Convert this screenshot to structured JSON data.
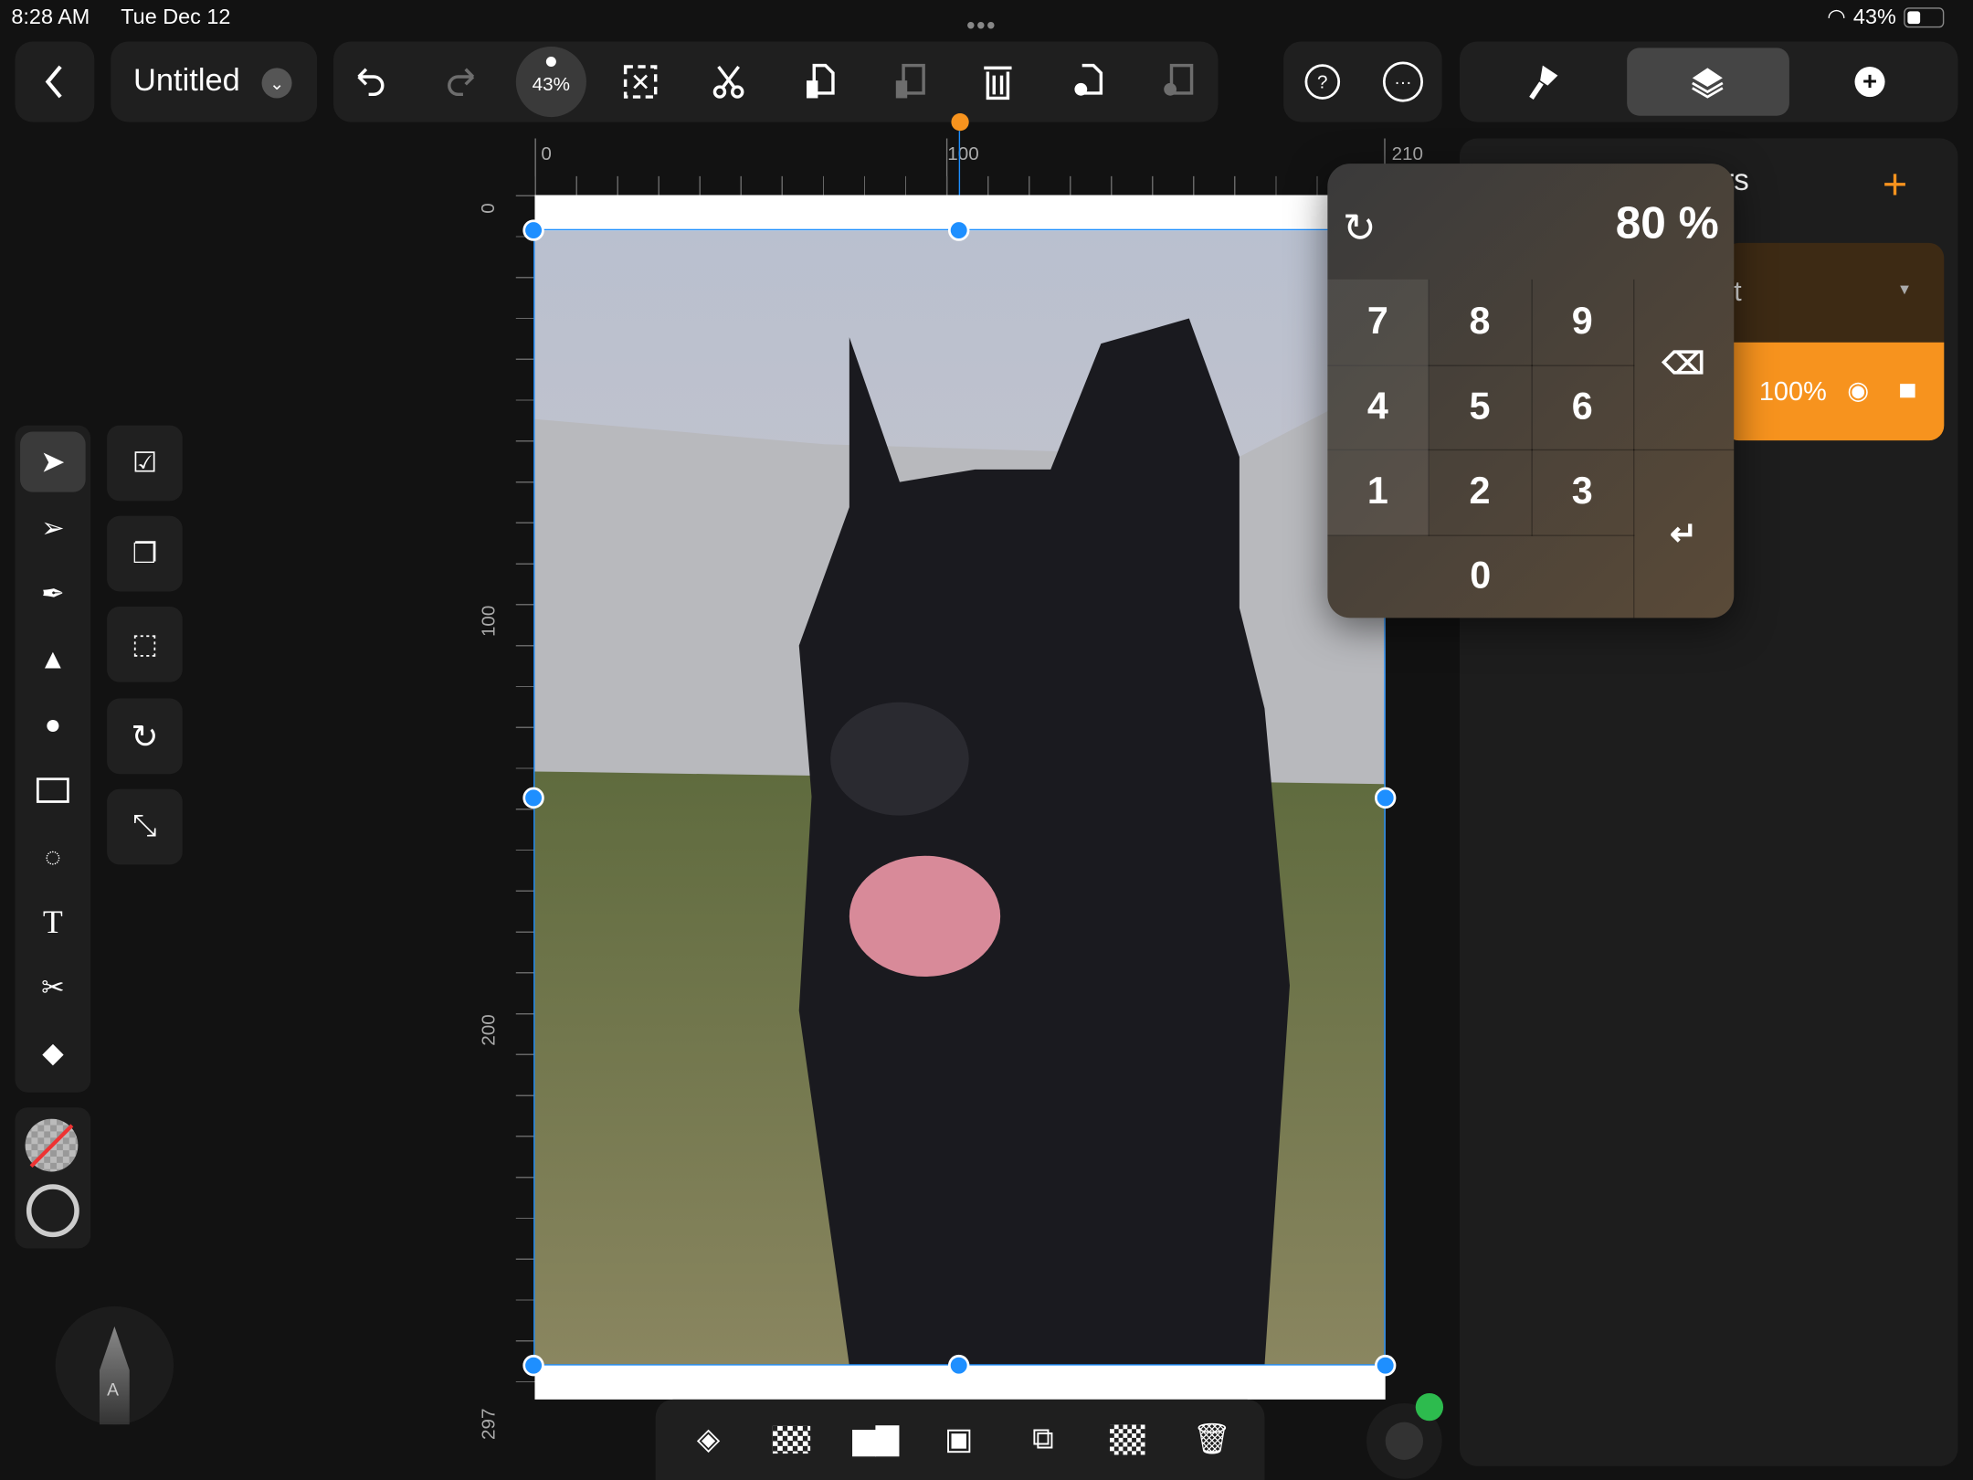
{
  "status": {
    "time": "8:28 AM",
    "date": "Tue Dec 12",
    "battery": "43%"
  },
  "header": {
    "title": "Untitled",
    "zoom": "43%"
  },
  "toolbar": {
    "icons": [
      "undo-icon",
      "redo-icon",
      "deselect-icon",
      "cut-icon",
      "copy-icon",
      "paste-icon",
      "delete-icon",
      "duplicate-icon",
      "paste-style-icon"
    ]
  },
  "ruler": {
    "h": [
      "0",
      "100",
      "210"
    ],
    "v": [
      "0",
      "100",
      "200",
      "297"
    ]
  },
  "keypad": {
    "value": "80 %",
    "keys": [
      "7",
      "8",
      "9",
      "4",
      "5",
      "6",
      "1",
      "2",
      "3",
      "0"
    ]
  },
  "layers": {
    "title_fragment": "rs",
    "layer_name_fragment": "t",
    "opacity": "100%"
  },
  "pencil": {
    "label": "A"
  },
  "colors": {
    "accent": "#f7931e",
    "selection": "#1e8fff",
    "background": "#121212"
  }
}
